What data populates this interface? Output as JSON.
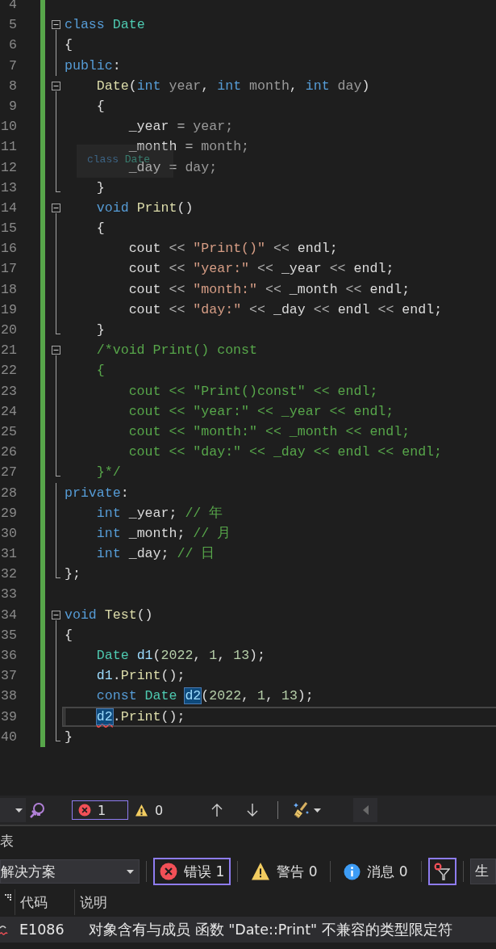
{
  "editor": {
    "lines": [
      {
        "number": "4",
        "modified": true
      },
      {
        "number": "5",
        "modified": true,
        "collapsible": true,
        "expanded": true,
        "tokens": [
          {
            "kind": "kw",
            "text": "class"
          },
          {
            "kind": "type",
            "text": " Date"
          }
        ]
      },
      {
        "number": "6",
        "modified": true,
        "in_block": true,
        "tokens": [
          {
            "kind": "plain",
            "text": "{"
          }
        ]
      },
      {
        "number": "7",
        "modified": true,
        "in_block": true,
        "tokens": [
          {
            "kind": "kw",
            "text": "public"
          },
          {
            "kind": "plain",
            "text": ":"
          }
        ]
      },
      {
        "number": "8",
        "modified": true,
        "collapsible": true,
        "expanded": true,
        "tokens": [
          {
            "kind": "fn",
            "text": "    Date"
          },
          {
            "kind": "plain",
            "text": "("
          },
          {
            "kind": "kw",
            "text": "int"
          },
          {
            "kind": "param",
            "text": " year"
          },
          {
            "kind": "plain",
            "text": ", "
          },
          {
            "kind": "kw",
            "text": "int"
          },
          {
            "kind": "param",
            "text": " month"
          },
          {
            "kind": "plain",
            "text": ", "
          },
          {
            "kind": "kw",
            "text": "int"
          },
          {
            "kind": "param",
            "text": " day"
          },
          {
            "kind": "plain",
            "text": ")"
          }
        ]
      },
      {
        "number": "9",
        "modified": true,
        "in_block": true,
        "tokens": [
          {
            "kind": "plain",
            "text": "    {"
          }
        ]
      },
      {
        "number": "10",
        "modified": true,
        "in_block": true,
        "tokens": [
          {
            "kind": "member",
            "text": "        _year"
          },
          {
            "kind": "op",
            "text": " = "
          },
          {
            "kind": "param",
            "text": "year;"
          }
        ]
      },
      {
        "number": "11",
        "modified": true,
        "in_block": true,
        "tokens": [
          {
            "kind": "member",
            "text": "        _month"
          },
          {
            "kind": "op",
            "text": " = "
          },
          {
            "kind": "param",
            "text": "month;"
          }
        ]
      },
      {
        "number": "12",
        "modified": true,
        "in_block": true,
        "tokens": [
          {
            "kind": "member",
            "text": "        _day"
          },
          {
            "kind": "op",
            "text": " = "
          },
          {
            "kind": "param",
            "text": "day;"
          }
        ]
      },
      {
        "number": "13",
        "modified": true,
        "block_end": true,
        "tokens": [
          {
            "kind": "plain",
            "text": "    }"
          }
        ]
      },
      {
        "number": "14",
        "modified": true,
        "collapsible": true,
        "expanded": true,
        "tokens": [
          {
            "kind": "kw",
            "text": "    void"
          },
          {
            "kind": "fn",
            "text": " Print"
          },
          {
            "kind": "plain",
            "text": "()"
          }
        ]
      },
      {
        "number": "15",
        "modified": true,
        "in_block": true,
        "tokens": [
          {
            "kind": "plain",
            "text": "    {"
          }
        ]
      },
      {
        "number": "16",
        "modified": true,
        "in_block": true,
        "tokens": [
          {
            "kind": "plain",
            "text": "        cout"
          },
          {
            "kind": "op",
            "text": " << "
          },
          {
            "kind": "str",
            "text": "\"Print()\""
          },
          {
            "kind": "op",
            "text": " << "
          },
          {
            "kind": "plain",
            "text": "endl;"
          }
        ]
      },
      {
        "number": "17",
        "modified": true,
        "in_block": true,
        "tokens": [
          {
            "kind": "plain",
            "text": "        cout"
          },
          {
            "kind": "op",
            "text": " << "
          },
          {
            "kind": "str",
            "text": "\"year:\""
          },
          {
            "kind": "op",
            "text": " << "
          },
          {
            "kind": "member",
            "text": "_year"
          },
          {
            "kind": "op",
            "text": " << "
          },
          {
            "kind": "plain",
            "text": "endl;"
          }
        ]
      },
      {
        "number": "18",
        "modified": true,
        "in_block": true,
        "tokens": [
          {
            "kind": "plain",
            "text": "        cout"
          },
          {
            "kind": "op",
            "text": " << "
          },
          {
            "kind": "str",
            "text": "\"month:\""
          },
          {
            "kind": "op",
            "text": " << "
          },
          {
            "kind": "member",
            "text": "_month"
          },
          {
            "kind": "op",
            "text": " << "
          },
          {
            "kind": "plain",
            "text": "endl;"
          }
        ]
      },
      {
        "number": "19",
        "modified": true,
        "in_block": true,
        "tokens": [
          {
            "kind": "plain",
            "text": "        cout"
          },
          {
            "kind": "op",
            "text": " << "
          },
          {
            "kind": "str",
            "text": "\"day:\""
          },
          {
            "kind": "op",
            "text": " << "
          },
          {
            "kind": "member",
            "text": "_day"
          },
          {
            "kind": "op",
            "text": " << "
          },
          {
            "kind": "plain",
            "text": "endl"
          },
          {
            "kind": "op",
            "text": " << "
          },
          {
            "kind": "plain",
            "text": "endl;"
          }
        ]
      },
      {
        "number": "20",
        "modified": true,
        "block_end": true,
        "tokens": [
          {
            "kind": "plain",
            "text": "    }"
          }
        ]
      },
      {
        "number": "21",
        "modified": true,
        "collapsible": true,
        "expanded": true,
        "tokens": [
          {
            "kind": "cmt",
            "text": "    /*void Print() const"
          }
        ]
      },
      {
        "number": "22",
        "modified": true,
        "in_block": true,
        "tokens": [
          {
            "kind": "cmt",
            "text": "    {"
          }
        ]
      },
      {
        "number": "23",
        "modified": true,
        "in_block": true,
        "tokens": [
          {
            "kind": "cmt",
            "text": "        cout << \"Print()const\" << endl;"
          }
        ]
      },
      {
        "number": "24",
        "modified": true,
        "in_block": true,
        "tokens": [
          {
            "kind": "cmt",
            "text": "        cout << \"year:\" << _year << endl;"
          }
        ]
      },
      {
        "number": "25",
        "modified": true,
        "in_block": true,
        "tokens": [
          {
            "kind": "cmt",
            "text": "        cout << \"month:\" << _month << endl;"
          }
        ]
      },
      {
        "number": "26",
        "modified": true,
        "in_block": true,
        "tokens": [
          {
            "kind": "cmt",
            "text": "        cout << \"day:\" << _day << endl << endl;"
          }
        ]
      },
      {
        "number": "27",
        "modified": true,
        "block_end": true,
        "tokens": [
          {
            "kind": "cmt",
            "text": "    }*/"
          }
        ]
      },
      {
        "number": "28",
        "modified": true,
        "in_block": true,
        "tokens": [
          {
            "kind": "kw",
            "text": "private"
          },
          {
            "kind": "plain",
            "text": ":"
          }
        ]
      },
      {
        "number": "29",
        "modified": true,
        "in_block": true,
        "tokens": [
          {
            "kind": "kw",
            "text": "    int"
          },
          {
            "kind": "member",
            "text": " _year; "
          },
          {
            "kind": "cmt",
            "text": "// 年"
          }
        ]
      },
      {
        "number": "30",
        "modified": true,
        "in_block": true,
        "tokens": [
          {
            "kind": "kw",
            "text": "    int"
          },
          {
            "kind": "member",
            "text": " _month; "
          },
          {
            "kind": "cmt",
            "text": "// 月"
          }
        ]
      },
      {
        "number": "31",
        "modified": true,
        "in_block": true,
        "tokens": [
          {
            "kind": "kw",
            "text": "    int"
          },
          {
            "kind": "member",
            "text": " _day; "
          },
          {
            "kind": "cmt",
            "text": "// 日"
          }
        ]
      },
      {
        "number": "32",
        "modified": true,
        "block_end": true,
        "tokens": [
          {
            "kind": "plain",
            "text": "};"
          }
        ]
      },
      {
        "number": "33",
        "modified": true
      },
      {
        "number": "34",
        "modified": true,
        "collapsible": true,
        "expanded": true,
        "tokens": [
          {
            "kind": "kw",
            "text": "void"
          },
          {
            "kind": "fn",
            "text": " Test"
          },
          {
            "kind": "plain",
            "text": "()"
          }
        ]
      },
      {
        "number": "35",
        "modified": true,
        "in_block": true,
        "tokens": [
          {
            "kind": "plain",
            "text": "{"
          }
        ]
      },
      {
        "number": "36",
        "modified": true,
        "in_block": true,
        "tokens": [
          {
            "kind": "type",
            "text": "    Date"
          },
          {
            "kind": "var",
            "text": " d1"
          },
          {
            "kind": "plain",
            "text": "("
          },
          {
            "kind": "num",
            "text": "2022"
          },
          {
            "kind": "plain",
            "text": ", "
          },
          {
            "kind": "num",
            "text": "1"
          },
          {
            "kind": "plain",
            "text": ", "
          },
          {
            "kind": "num",
            "text": "13"
          },
          {
            "kind": "plain",
            "text": ");"
          }
        ]
      },
      {
        "number": "37",
        "modified": true,
        "in_block": true,
        "tokens": [
          {
            "kind": "var",
            "text": "    d1"
          },
          {
            "kind": "plain",
            "text": "."
          },
          {
            "kind": "fn",
            "text": "Print"
          },
          {
            "kind": "plain",
            "text": "();"
          }
        ]
      },
      {
        "number": "38",
        "modified": true,
        "in_block": true,
        "tokens": [
          {
            "kind": "kw",
            "text": "    const"
          },
          {
            "kind": "type",
            "text": " Date "
          },
          {
            "kind": "var",
            "text": "d2",
            "highlighted": true
          },
          {
            "kind": "plain",
            "text": "("
          },
          {
            "kind": "num",
            "text": "2022"
          },
          {
            "kind": "plain",
            "text": ", "
          },
          {
            "kind": "num",
            "text": "1"
          },
          {
            "kind": "plain",
            "text": ", "
          },
          {
            "kind": "num",
            "text": "13"
          },
          {
            "kind": "plain",
            "text": ");"
          }
        ]
      },
      {
        "number": "39",
        "modified": true,
        "current": true,
        "in_block": true,
        "indented": true,
        "tokens": [
          {
            "kind": "var",
            "text": "d2",
            "highlighted": true,
            "error": true
          },
          {
            "kind": "plain",
            "text": "."
          },
          {
            "kind": "fn",
            "text": "Print"
          },
          {
            "kind": "plain",
            "text": "();"
          }
        ]
      },
      {
        "number": "40",
        "modified": true,
        "block_end": true,
        "tokens": [
          {
            "kind": "plain",
            "text": "}"
          }
        ]
      }
    ],
    "hint": {
      "tokens": [
        {
          "kind": "kw",
          "text": "class"
        },
        {
          "kind": "type",
          "text": " Date"
        }
      ]
    }
  },
  "editor_status": {
    "errors": {
      "count": "1",
      "selected": true
    },
    "warnings": {
      "count": "0",
      "selected": false
    }
  },
  "error_list": {
    "title": "表",
    "scope": "解决方案",
    "filters": [
      {
        "kind": "error",
        "label": "错误 1",
        "selected": true
      },
      {
        "kind": "warning",
        "label": "警告 0",
        "selected": false
      },
      {
        "kind": "info",
        "label": "消息 0",
        "selected": false
      }
    ],
    "filter_button": {
      "selected": true
    },
    "build_label": "生",
    "columns": [
      "代码",
      "说明"
    ],
    "rows": [
      {
        "code": "E1086",
        "description": "对象含有与成员 函数 \"Date::Print\" 不兼容的类型限定符",
        "selected": true
      }
    ]
  }
}
